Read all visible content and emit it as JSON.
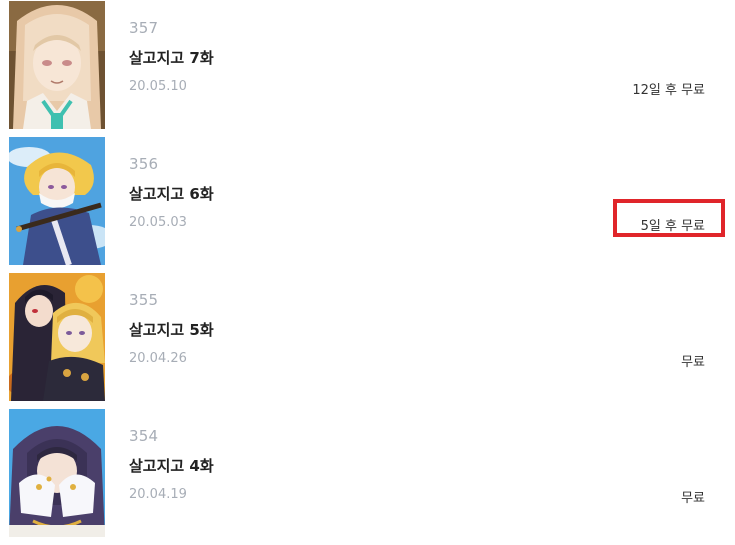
{
  "episodes": [
    {
      "number": "357",
      "title": "살고지고 7화",
      "date": "20.05.10",
      "status": "12일 후 무료",
      "thumbnail": "episode-357-cover"
    },
    {
      "number": "356",
      "title": "살고지고 6화",
      "date": "20.05.03",
      "status": "5일 후 무료",
      "thumbnail": "episode-356-cover"
    },
    {
      "number": "355",
      "title": "살고지고 5화",
      "date": "20.04.26",
      "status": "무료",
      "thumbnail": "episode-355-cover"
    },
    {
      "number": "354",
      "title": "살고지고 4화",
      "date": "20.04.19",
      "status": "무료",
      "thumbnail": "episode-354-cover"
    }
  ],
  "highlight": {
    "color": "#e0252a",
    "target_episode": "356"
  },
  "colors": {
    "meta_text": "#a7adb6",
    "title_text": "#222222",
    "status_text": "#333333"
  }
}
